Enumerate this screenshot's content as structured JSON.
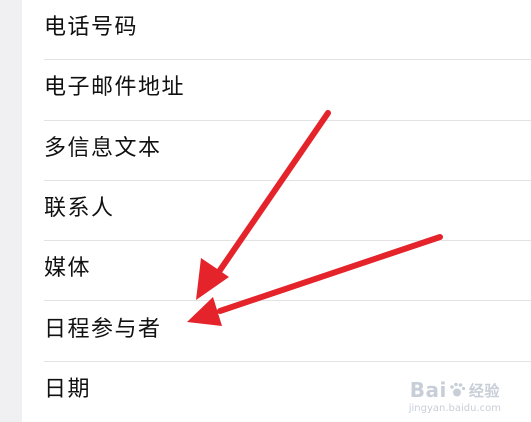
{
  "list": {
    "items": [
      {
        "label": "电话号码"
      },
      {
        "label": "电子邮件地址"
      },
      {
        "label": "多信息文本"
      },
      {
        "label": "联系人"
      },
      {
        "label": "媒体"
      },
      {
        "label": "日程参与者"
      },
      {
        "label": "日期"
      }
    ]
  },
  "annotations": {
    "arrow_color": "#e5232a"
  },
  "watermark": {
    "brand": "Bai",
    "brand_suffix": "经验",
    "url": "jingyan.baidu.com"
  },
  "colors": {
    "background": "#f0f0f3",
    "card": "#ffffff",
    "divider": "#e3e3e6",
    "text": "#111111"
  }
}
